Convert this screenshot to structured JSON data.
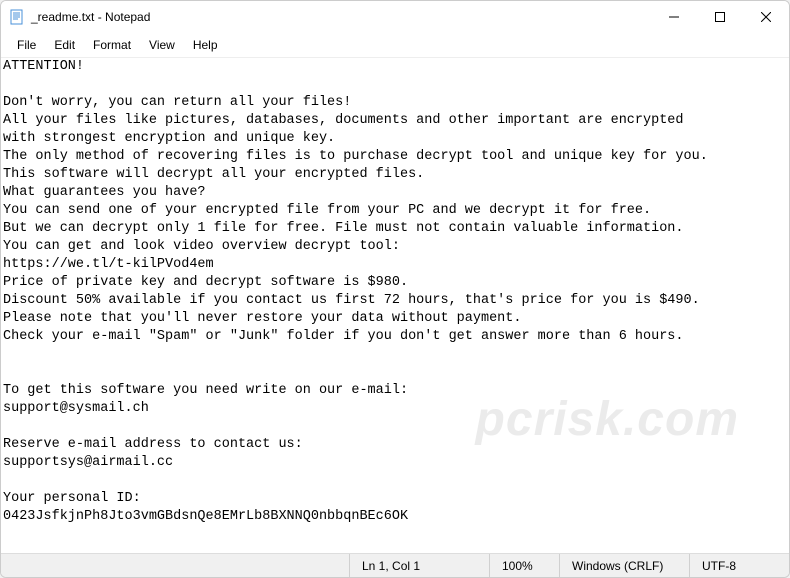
{
  "titlebar": {
    "title": "_readme.txt - Notepad"
  },
  "menubar": {
    "file": "File",
    "edit": "Edit",
    "format": "Format",
    "view": "View",
    "help": "Help"
  },
  "document": {
    "content": "ATTENTION!\n\nDon't worry, you can return all your files!\nAll your files like pictures, databases, documents and other important are encrypted\nwith strongest encryption and unique key.\nThe only method of recovering files is to purchase decrypt tool and unique key for you.\nThis software will decrypt all your encrypted files.\nWhat guarantees you have?\nYou can send one of your encrypted file from your PC and we decrypt it for free.\nBut we can decrypt only 1 file for free. File must not contain valuable information.\nYou can get and look video overview decrypt tool:\nhttps://we.tl/t-kilPVod4em\nPrice of private key and decrypt software is $980.\nDiscount 50% available if you contact us first 72 hours, that's price for you is $490.\nPlease note that you'll never restore your data without payment.\nCheck your e-mail \"Spam\" or \"Junk\" folder if you don't get answer more than 6 hours.\n\n\nTo get this software you need write on our e-mail:\nsupport@sysmail.ch\n\nReserve e-mail address to contact us:\nsupportsys@airmail.cc\n\nYour personal ID:\n0423JsfkjnPh8Jto3vmGBdsnQe8EMrLb8BXNNQ0nbbqnBEc6OK"
  },
  "statusbar": {
    "position": "Ln 1, Col 1",
    "zoom": "100%",
    "line_ending": "Windows (CRLF)",
    "encoding": "UTF-8"
  },
  "watermark": "pcrisk.com"
}
